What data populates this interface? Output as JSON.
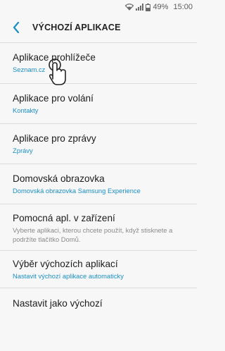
{
  "status_bar": {
    "battery": "49%",
    "time": "15:00",
    "icons": [
      "wifi-icon",
      "signal-icon",
      "battery-icon"
    ]
  },
  "app_bar": {
    "title": "VÝCHOZÍ APLIKACE",
    "back_icon": "chevron-left-icon"
  },
  "items": [
    {
      "title": "Aplikace prohlížeče",
      "sub": "Seznam.cz"
    },
    {
      "title": "Aplikace pro volání",
      "sub": "Kontakty"
    },
    {
      "title": "Aplikace pro zprávy",
      "sub": "Zprávy"
    },
    {
      "title": "Domovská obrazovka",
      "sub": "Domovská obrazovka Samsung Experience"
    },
    {
      "title": "Pomocná apl. v zařízení",
      "desc": "Vyberte aplikaci, kterou chcete použít, když stisknete a podržíte tlačítko Domů."
    },
    {
      "title": "Výběr výchozích aplikací",
      "sub": "Nastavit výchozí aplikace automaticky"
    },
    {
      "title": "Nastavit jako výchozí"
    }
  ],
  "colors": {
    "accent": "#1a8fc2",
    "background": "#f7f7f7",
    "divider": "#dcdcdc"
  }
}
